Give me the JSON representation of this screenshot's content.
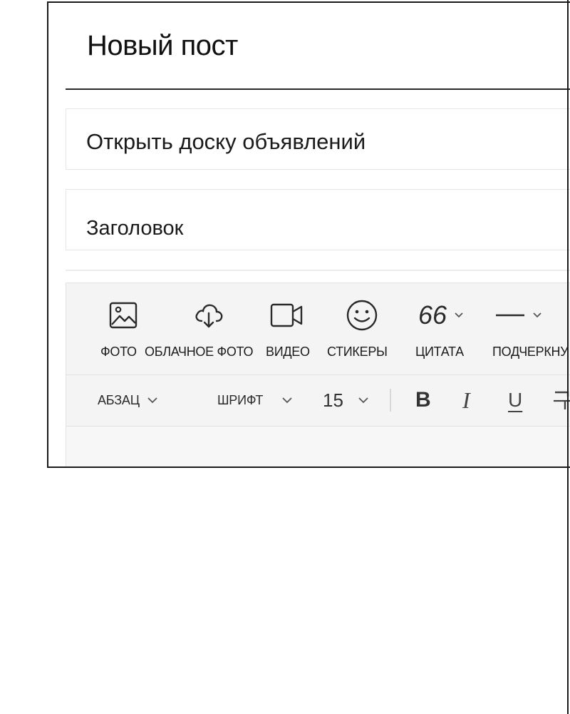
{
  "page": {
    "title": "Новый пост"
  },
  "fields": {
    "board": "Открыть доску объявлений",
    "heading": "Заголовок"
  },
  "toolbar": {
    "media": [
      {
        "label": "ФОТО",
        "icon": "image-icon"
      },
      {
        "label": "ОБЛАЧНОЕ ФОТО",
        "icon": "cloud-download-icon"
      },
      {
        "label": "ВИДЕО",
        "icon": "video-camera-icon"
      },
      {
        "label": "СТИКЕРЫ",
        "icon": "smiley-icon"
      },
      {
        "label": "ЦИТАТА",
        "icon": "quote-icon",
        "glyph": "66"
      },
      {
        "label": "ПОДЧЕРКНУ",
        "icon": "horizontal-line-icon"
      }
    ],
    "format": {
      "paragraph": "АБЗАЦ",
      "font": "ШРИФТ",
      "size": "15",
      "bold": "B",
      "italic": "I",
      "underline": "U"
    }
  }
}
